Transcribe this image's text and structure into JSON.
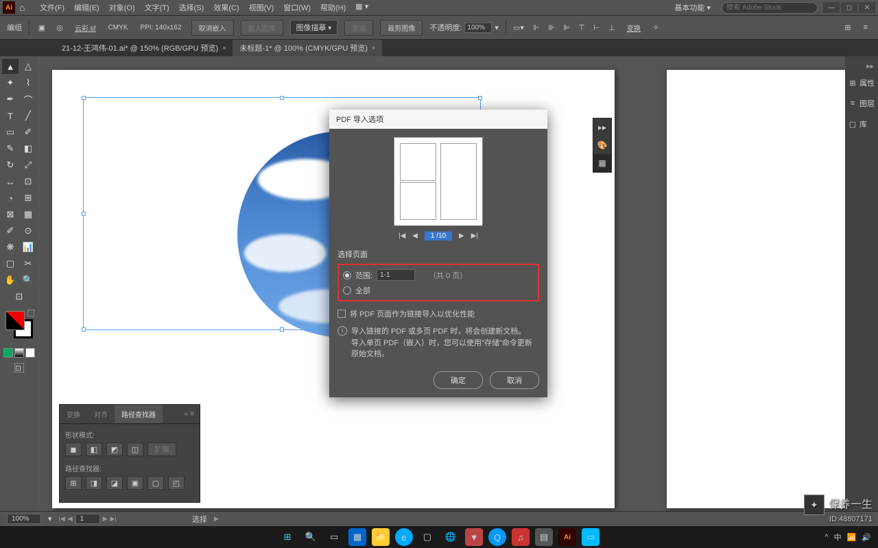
{
  "menu": {
    "file": "文件(F)",
    "edit": "编辑(E)",
    "object": "对象(O)",
    "text": "文字(T)",
    "select": "选择(S)",
    "effect": "效果(C)",
    "view": "视图(V)",
    "window": "窗口(W)",
    "help": "帮助(H)"
  },
  "workspace": "基本功能",
  "search_ph": "搜索 Adobe Stock",
  "control": {
    "label": "编组",
    "file": "云彩.tif",
    "mode": "CMYK",
    "ppi": "PPI: 140x162",
    "cancel_embed": "取消嵌入",
    "embed_img": "嵌入图像",
    "crop": "图像描摹",
    "mask": "蒙版",
    "crop_img": "裁剪图像",
    "opacity_lbl": "不透明度:",
    "opacity": "100%",
    "transform": "变换"
  },
  "tabs": {
    "t1": "21-12-王鸿伟-01.ai* @ 150% (RGB/GPU 预览)",
    "t2": "未标题-1* @ 100% (CMYK/GPU 预览)"
  },
  "right_panels": {
    "p1": "属性",
    "p2": "图层",
    "p3": "库"
  },
  "dialog": {
    "title": "PDF 导入选项",
    "page_input": "1 /10",
    "section": "选择页面",
    "range_lbl": "范围:",
    "range_val": "1-1",
    "total": "（共  0 页）",
    "all_lbl": "全部",
    "checkbox": "将 PDF 页面作为链接导入以优化性能",
    "info1": "导入链接的 PDF 或多页 PDF 时，将会创建新文档。",
    "info2": "导入单页 PDF（嵌入）时，您可以使用\"存储\"命令更新原始文档。",
    "ok": "确定",
    "cancel": "取消"
  },
  "pathfinder": {
    "t1": "变换",
    "t2": "对齐",
    "t3": "路径查找器",
    "shape": "形状模式:",
    "find": "路径查找器:",
    "expand": "扩展"
  },
  "status": {
    "zoom": "100%",
    "page": "1",
    "select": "选择"
  },
  "watermark": {
    "name": "保养一生",
    "id": "ID:48807171"
  }
}
